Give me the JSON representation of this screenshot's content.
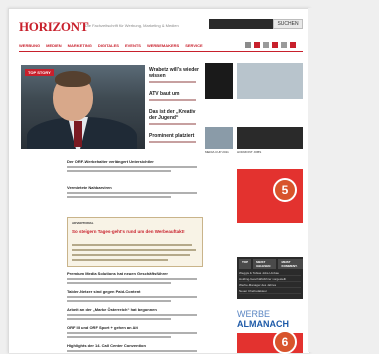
{
  "header": {
    "logo": "HORIZONT",
    "tagline": "Die Fachzeitschrift für Werbung, Marketing & Medien",
    "search_button": "SUCHEN"
  },
  "nav": [
    "WERBUNG",
    "MEDIEN",
    "MARKETING",
    "DIGITALES",
    "EVENTS",
    "WERBEMAKERS",
    "SERVICE"
  ],
  "social_colors": [
    "#8b8b8b",
    "#c8202c",
    "#9a9a9a",
    "#c8202c",
    "#9a9a9a",
    "#c8202c"
  ],
  "hero": {
    "tag": "TOP STORY"
  },
  "side_news": [
    "Wrabetz will's wieder wissen",
    "ATV baut um",
    "Das ist der „Kreativ der Jugend“",
    "Prominent platziert"
  ],
  "articles": [
    "Der ORF-Werbehalter verlängert Untersichtler",
    "Vermietete Nahbarviren",
    "Premium Media Solutions hat neuen Geschäftsführer",
    "Tabler-Netzer sind gegen Paid-Content",
    "Arbeit an der „Marke Österreich“ hat begonnen",
    "ORF III und ORF Sport + gehen an Ait",
    "Highlights der 14. Call Center Convention"
  ],
  "highlight": {
    "heading": "ADVERTORIAL",
    "title": "So steigern Tages-geht's rund um den Werbeauftakt!"
  },
  "thumbs": [
    {
      "caption": "",
      "color": "#1a1a1a"
    },
    {
      "caption": "",
      "color": "#b8c4cc"
    },
    {
      "caption": "MEDIA CUP 2011",
      "color": "#8a9ba8"
    },
    {
      "caption": "HORIZONT JOBS",
      "color": "#2a2a2a"
    }
  ],
  "badges": [
    "5",
    "6"
  ],
  "promo": {
    "tabs": [
      "TOP",
      "MEIST GELESEN",
      "MEIST KOMMENT."
    ],
    "rows": [
      "Weggis & Tobias Jobs-Umbau",
      "Holding-Geschäftsführer vorgestellt",
      "Werbe-Manager des Jahres",
      "Neuer Chefredakteur"
    ]
  },
  "almanach": {
    "part1": "WERBE",
    "part2": "ALMANACH"
  }
}
